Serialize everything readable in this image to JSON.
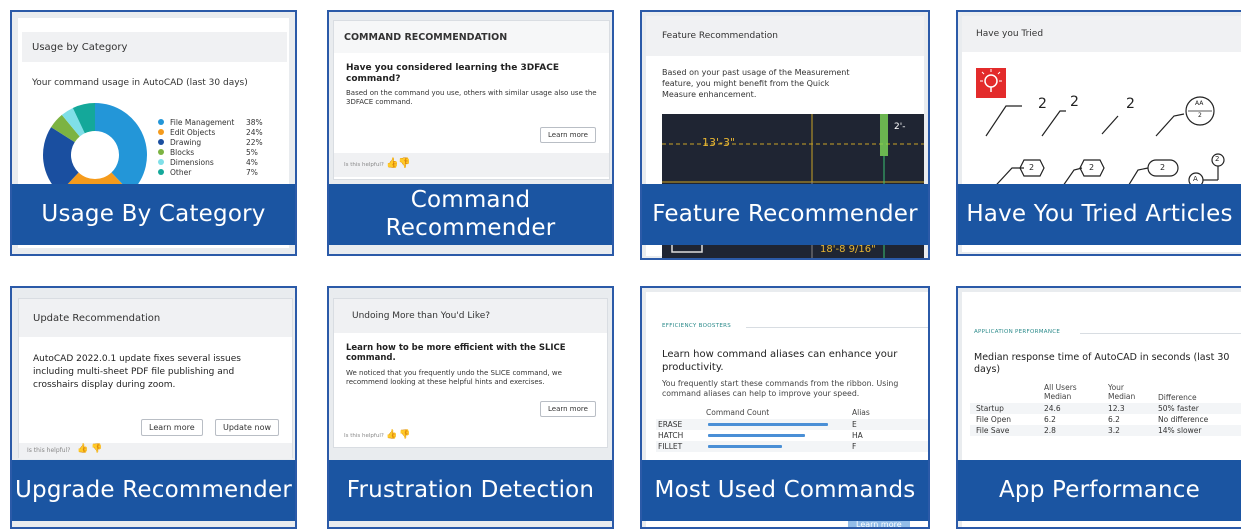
{
  "tiles": {
    "usage": {
      "header": "Usage by Category",
      "subtitle": "Your command usage in AutoCAD (last 30 days)",
      "legend": [
        {
          "label": "File Management",
          "pct": "38%",
          "value": 38,
          "color": "#2396d8"
        },
        {
          "label": "Edit Objects",
          "pct": "24%",
          "value": 24,
          "color": "#f59b1c"
        },
        {
          "label": "Drawing",
          "pct": "22%",
          "value": 22,
          "color": "#1a4fa0"
        },
        {
          "label": "Blocks",
          "pct": "5%",
          "value": 5,
          "color": "#7cb342"
        },
        {
          "label": "Dimensions",
          "pct": "4%",
          "value": 4,
          "color": "#7fdfe8"
        },
        {
          "label": "Other",
          "pct": "7%",
          "value": 7,
          "color": "#14a89a"
        }
      ],
      "banner": "Usage By Category"
    },
    "command": {
      "header": "COMMAND RECOMMENDATION",
      "question": "Have you considered learning the 3DFACE command?",
      "body": "Based on the command you use, others with similar usage also use the 3DFACE command.",
      "button": "Learn more",
      "helpful": "Is this helpful?",
      "banner_line1": "Command",
      "banner_line2": "Recommender"
    },
    "feature": {
      "header": "Feature Recommendation",
      "body": "Based on your past usage of the Measurement feature, you might benefit from the Quick Measure enhancement.",
      "dim1": "13'-3\"",
      "dim2": "2'-",
      "dim3": "18'-8 9/16\"",
      "banner": "Feature Recommender"
    },
    "tried": {
      "header": "Have you Tried",
      "num": "2",
      "aa_top": "AA",
      "aa_bottom": "2",
      "circ_a": "A",
      "banner": "Have You Tried Articles"
    },
    "upgrade": {
      "header": "Update Recommendation",
      "body": "AutoCAD 2022.0.1 update fixes several issues including multi-sheet PDF file publishing and crosshairs display during zoom.",
      "learn": "Learn more",
      "update": "Update now",
      "helpful": "Is this helpful?",
      "banner": "Upgrade Recommender"
    },
    "frustration": {
      "header": "Undoing More than You'd Like?",
      "title": "Learn how to be more efficient with the SLICE command.",
      "body": "We noticed that you frequently undo the SLICE command, we recommend looking at these helpful hints and exercises.",
      "button": "Learn more",
      "helpful": "Is this helpful?",
      "banner": "Frustration Detection"
    },
    "most_used": {
      "section": "EFFICIENCY BOOSTERS",
      "title": "Learn how command aliases can enhance your productivity.",
      "body": "You frequently start these commands from the ribbon. Using command aliases can help to improve your speed.",
      "col_count": "Command Count",
      "col_alias": "Alias",
      "rows": [
        {
          "cmd": "ERASE",
          "count": 1.0,
          "alias": "E"
        },
        {
          "cmd": "HATCH",
          "count": 0.81,
          "alias": "HA"
        },
        {
          "cmd": "FILLET",
          "count": 0.62,
          "alias": "F"
        }
      ],
      "button": "Learn more",
      "banner": "Most Used Commands"
    },
    "performance": {
      "section": "APPLICATION PERFORMANCE",
      "title": "Median response time of AutoCAD in seconds (last 30 days)",
      "col_all_1": "All Users",
      "col_all_2": "Median",
      "col_your_1": "Your",
      "col_your_2": "Median",
      "col_diff": "Difference",
      "rows": [
        {
          "name": "Startup",
          "all": "24.6",
          "your": "12.3",
          "diff": "50% faster"
        },
        {
          "name": "File Open",
          "all": "6.2",
          "your": "6.2",
          "diff": "No difference"
        },
        {
          "name": "File Save",
          "all": "2.8",
          "your": "3.2",
          "diff": "14% slower"
        }
      ],
      "banner": "App Performance"
    }
  }
}
